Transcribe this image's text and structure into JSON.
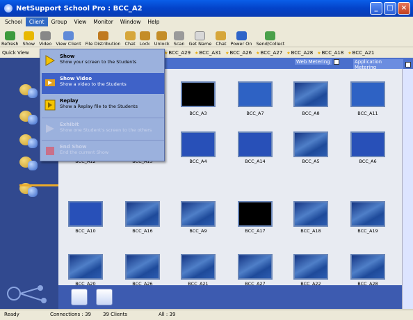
{
  "window": {
    "title": "NetSupport School Pro : BCC_A2",
    "minimize": "_",
    "maximize": "□",
    "close": "×"
  },
  "menu": [
    "School",
    "Client",
    "Group",
    "View",
    "Monitor",
    "Window",
    "Help"
  ],
  "toolbar": [
    "Refresh",
    "Show",
    "Video",
    "View Client",
    "File Distribution",
    "Chat",
    "Lock",
    "Unlock",
    "Scan",
    "Get Name",
    "Chat",
    "Power On",
    "Send/Collect"
  ],
  "quick_view_label": "Quick View",
  "group_tabs": [
    "BCC_A29",
    "BCC_A31",
    "BCC_A26",
    "BCC_A27",
    "BCC_A28",
    "BCC_A18",
    "BCC_A21"
  ],
  "view_modes": {
    "web_metering": "Web Metering",
    "application_metering": "Application Metering"
  },
  "dropdown": [
    {
      "title": "Show",
      "desc": "Show your screen to the Students",
      "state": "normal"
    },
    {
      "title": "Show Video",
      "desc": "Show a video to the Students",
      "state": "hover"
    },
    {
      "title": "Replay",
      "desc": "Show a Replay file to the Students",
      "state": "normal"
    },
    {
      "title": "Exhibit",
      "desc": "Show one Student's screen to the others",
      "state": "disabled"
    },
    {
      "title": "End Show",
      "desc": "End the current Show",
      "state": "disabled"
    }
  ],
  "clients": [
    {
      "name": "BCC_A3",
      "screen": "wave"
    },
    {
      "name": "BCC_A7",
      "screen": "desktop"
    },
    {
      "name": "BCC_A8",
      "screen": "wave"
    },
    {
      "name": "BCC_A11",
      "screen": "desktop"
    },
    {
      "name": "BCC_A12",
      "screen": "wave"
    },
    {
      "name": "BCC_A13",
      "screen": "wave"
    },
    {
      "name": "BCC_A4",
      "screen": "desktop"
    },
    {
      "name": "BCC_A14",
      "screen": "desktop"
    },
    {
      "name": "BCC_A5",
      "screen": "wave"
    },
    {
      "name": "BCC_A6",
      "screen": "blue"
    },
    {
      "name": "BCC_A10",
      "screen": "blue"
    },
    {
      "name": "BCC_A16",
      "screen": "wave"
    },
    {
      "name": "BCC_A9",
      "screen": "wave"
    },
    {
      "name": "BCC_A17",
      "screen": "black"
    },
    {
      "name": "BCC_A18",
      "screen": "wave"
    },
    {
      "name": "BCC_A19",
      "screen": "wave"
    },
    {
      "name": "BCC_A20",
      "screen": "wave"
    },
    {
      "name": "BCC_A26",
      "screen": "wave"
    },
    {
      "name": "BCC_A21",
      "screen": "wave"
    },
    {
      "name": "BCC_A27",
      "screen": "wave"
    },
    {
      "name": "BCC_A22",
      "screen": "wave"
    },
    {
      "name": "BCC_A28",
      "screen": "wave"
    }
  ],
  "status": {
    "ready": "Ready",
    "connections": "Connections : 39",
    "clients": "39 Clients",
    "all": "All : 39"
  }
}
